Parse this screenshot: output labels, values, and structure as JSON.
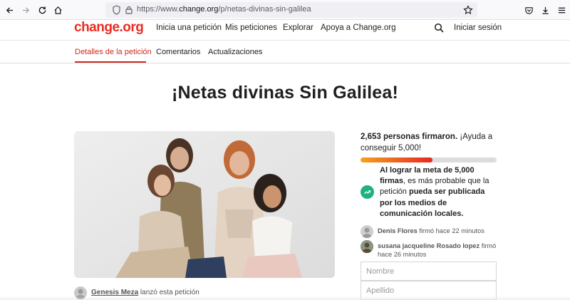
{
  "browser": {
    "url_prefix": "https://www.",
    "url_domain": "change.org",
    "url_path": "/p/netas-divinas-sin-galilea"
  },
  "header": {
    "logo": "change.org",
    "nav": [
      "Inicia una petición",
      "Mis peticiones",
      "Explorar",
      "Apoya a Change.org"
    ],
    "login": "Iniciar sesión"
  },
  "tabs": [
    "Detalles de la petición",
    "Comentarios",
    "Actualizaciones"
  ],
  "petition": {
    "title": "¡Netas divinas Sin Galilea!",
    "launcher_name": "Genesis Meza",
    "launcher_suffix": " lanzó esta petición"
  },
  "signatures": {
    "count_text": "2,653 personas firmaron.",
    "help_text": " ¡Ayuda a conseguir 5,000!",
    "progress": 0.53,
    "goal_bold_1": "Al lograr la meta de 5,000 firmas",
    "goal_mid": ", es más probable que la petición ",
    "goal_bold_2": "pueda ser publicada por los medios de comunicación locales."
  },
  "recent_signers": [
    {
      "name": "Denis Flores",
      "action": " firmó hace 22 minutos"
    },
    {
      "name": "susana jacqueline Rosado lopez",
      "action": " firmó hace 26 minutos"
    }
  ],
  "form": {
    "first_name_placeholder": "Nombre",
    "last_name_placeholder": "Apellido"
  },
  "colors": {
    "brand": "#ec2c22",
    "active_tab": "#cf2b1f",
    "trend_icon": "#1fb27a"
  }
}
